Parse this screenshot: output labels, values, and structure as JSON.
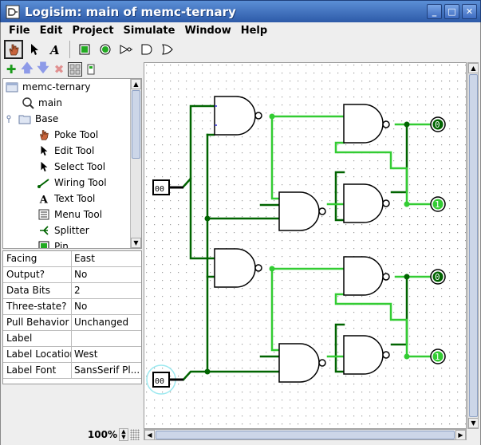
{
  "window": {
    "title": "Logisim: main of memc-ternary",
    "minimize_icon": "minimize-icon",
    "maximize_icon": "maximize-icon",
    "close_icon": "close-icon"
  },
  "menubar": {
    "items": [
      "File",
      "Edit",
      "Project",
      "Simulate",
      "Window",
      "Help"
    ]
  },
  "toolbar": {
    "tools": [
      "poke-tool-icon",
      "select-tool-icon",
      "text-tool-icon",
      "pin-input-icon",
      "pin-output-icon",
      "not-gate-icon",
      "and-gate-icon",
      "or-gate-icon"
    ]
  },
  "explorer": {
    "buttons": [
      "add-circuit-icon",
      "move-up-icon",
      "move-down-icon",
      "delete-icon",
      "view-toolbox-icon",
      "view-simulation-icon"
    ],
    "items": [
      {
        "label": "memc-ternary",
        "icon": "project-icon"
      },
      {
        "label": "main",
        "icon": "circuit-magnifier-icon"
      },
      {
        "label": "Base",
        "icon": "folder-icon"
      },
      {
        "label": "Poke Tool",
        "icon": "poke-hand-icon"
      },
      {
        "label": "Edit Tool",
        "icon": "edit-arrow-icon"
      },
      {
        "label": "Select Tool",
        "icon": "select-arrow-icon"
      },
      {
        "label": "Wiring Tool",
        "icon": "wiring-icon"
      },
      {
        "label": "Text Tool",
        "icon": "text-a-icon"
      },
      {
        "label": "Menu Tool",
        "icon": "menu-icon"
      },
      {
        "label": "Splitter",
        "icon": "splitter-icon"
      },
      {
        "label": "Pin",
        "icon": "pin-icon"
      }
    ]
  },
  "properties": [
    {
      "key": "Facing",
      "value": "East"
    },
    {
      "key": "Output?",
      "value": "No"
    },
    {
      "key": "Data Bits",
      "value": "2"
    },
    {
      "key": "Three-state?",
      "value": "No"
    },
    {
      "key": "Pull Behavior",
      "value": "Unchanged"
    },
    {
      "key": "Label",
      "value": ""
    },
    {
      "key": "Label Location",
      "value": "West"
    },
    {
      "key": "Label Font",
      "value": "SansSerif Pl..."
    }
  ],
  "zoom": {
    "value": "100%"
  },
  "circuit": {
    "input_pin_1_value": "00",
    "input_pin_2_value": "00",
    "output_1_value": "0",
    "output_2_value": "1",
    "output_3_value": "0",
    "output_4_value": "1",
    "colors": {
      "wire_off": "#006400",
      "wire_on": "#32cd32",
      "pin_bus": "#000000"
    }
  }
}
